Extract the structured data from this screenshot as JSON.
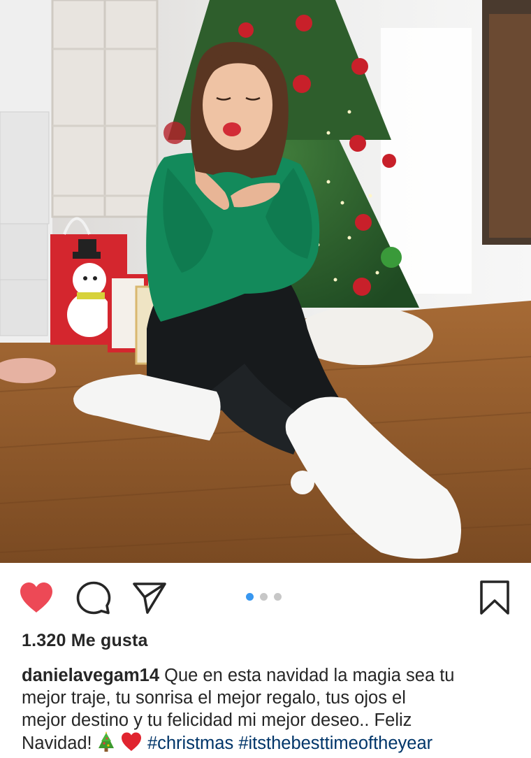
{
  "post": {
    "image_alt": "",
    "carousel": {
      "count": 3,
      "active_index": 0
    },
    "likes_text": "1.320 Me gusta",
    "caption": {
      "username": "danielavegam14",
      "text_line_1": "Que en esta navidad la magia sea tu",
      "text_line_2": "mejor traje, tu sonrisa el mejor regalo, tus ojos el",
      "text_line_3": "mejor destino y tu felicidad mi mejor deseo.. Feliz",
      "text_line_4_prefix": "Navidad!",
      "emojis": [
        "christmas-tree",
        "red-heart"
      ],
      "hashtags": [
        "#christmas",
        "#itsthebesttimeoftheyear"
      ]
    }
  },
  "actions": {
    "like_icon": "heart-icon",
    "liked": true,
    "comment_icon": "comment-icon",
    "share_icon": "paper-plane-icon",
    "save_icon": "bookmark-icon"
  },
  "colors": {
    "like_red": "#ed4956",
    "pager_active": "#3897f0",
    "pager_inactive": "#c7c7c7",
    "hashtag": "#003569",
    "text": "#262626"
  }
}
